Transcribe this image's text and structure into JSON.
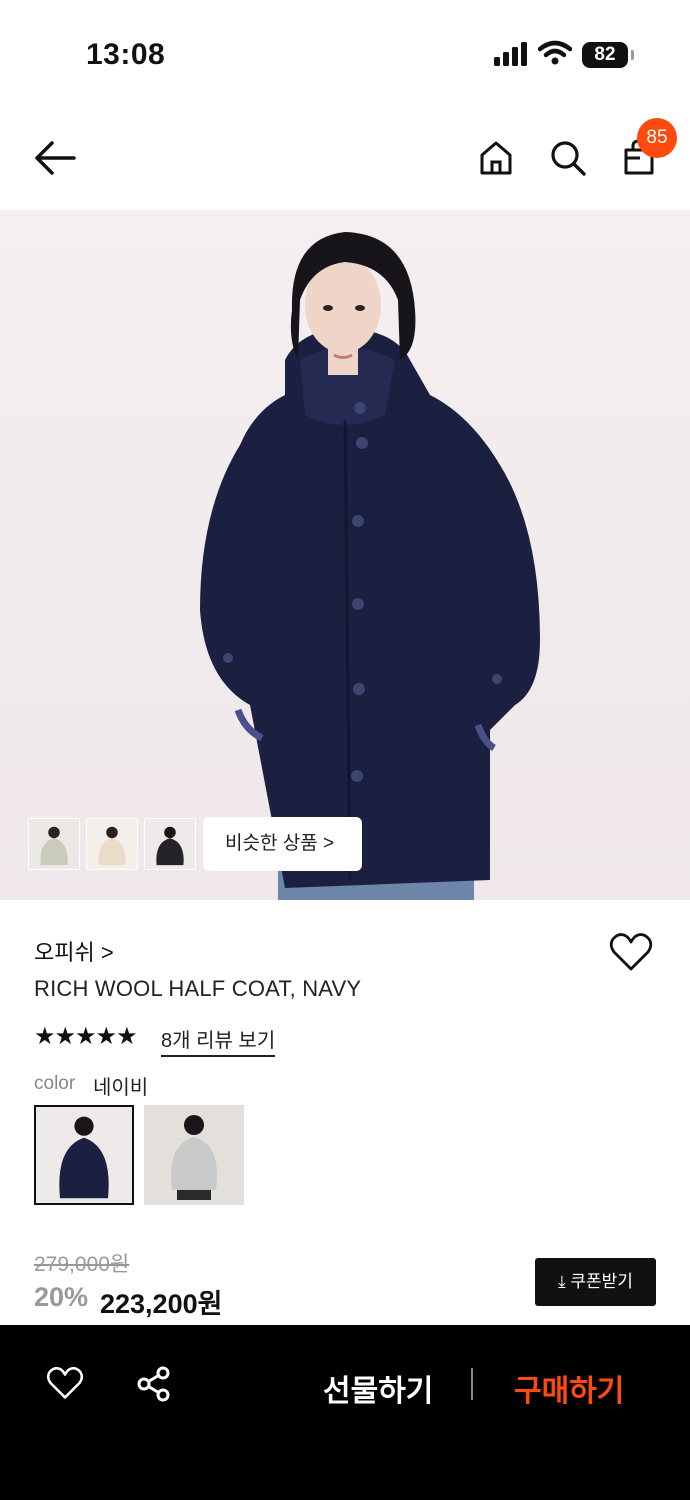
{
  "status_bar": {
    "time": "13:08",
    "battery": "82"
  },
  "header": {
    "cart_count": "85"
  },
  "gallery": {
    "similar_label": "비슷한 상품 >"
  },
  "product": {
    "brand": "오피쉬 >",
    "name": "RICH WOOL HALF COAT, NAVY",
    "stars": "★★★★★",
    "rating": 5,
    "reviews_link": "8개 리뷰 보기",
    "color_label": "color",
    "color_value": "네이비",
    "original_price": "279,000원",
    "discount": "20%",
    "price": "223,200원",
    "coupon_label": "⤓ 쿠폰받기"
  },
  "bottom_bar": {
    "gift_label": "선물하기",
    "buy_label": "구매하기"
  },
  "colors": {
    "accent": "#ff4a0e",
    "navy": "#1c2040"
  },
  "icons": [
    "back-arrow-icon",
    "home-icon",
    "search-icon",
    "cart-icon",
    "heart-icon",
    "share-icon"
  ]
}
